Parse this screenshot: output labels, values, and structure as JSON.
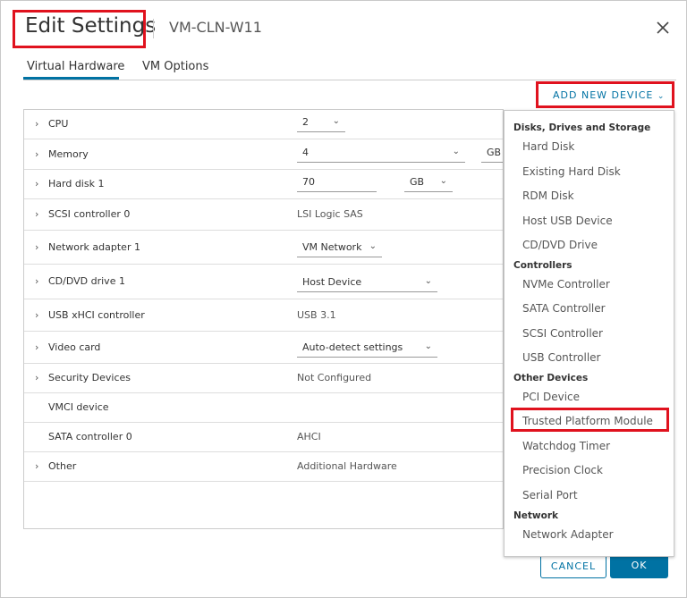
{
  "header": {
    "title": "Edit Settings",
    "vm_name": "VM-CLN-W11"
  },
  "tabs": [
    {
      "label": "Virtual Hardware",
      "active": true
    },
    {
      "label": "VM Options",
      "active": false
    }
  ],
  "toolbar": {
    "add_device_label": "ADD NEW DEVICE"
  },
  "hardware": {
    "cpu": {
      "label": "CPU",
      "value": "2"
    },
    "memory": {
      "label": "Memory",
      "value": "4",
      "unit": "GB"
    },
    "hard_disk": {
      "label": "Hard disk 1",
      "value": "70",
      "unit": "GB"
    },
    "scsi": {
      "label": "SCSI controller 0",
      "value": "LSI Logic SAS"
    },
    "network": {
      "label": "Network adapter 1",
      "value": "VM Network"
    },
    "cdrom": {
      "label": "CD/DVD drive 1",
      "value": "Host Device"
    },
    "usb": {
      "label": "USB xHCI controller",
      "value": "USB 3.1"
    },
    "video": {
      "label": "Video card",
      "value": "Auto-detect settings"
    },
    "security": {
      "label": "Security Devices",
      "value": "Not Configured"
    },
    "vmci": {
      "label": "VMCI device"
    },
    "sata": {
      "label": "SATA controller 0",
      "value": "AHCI"
    },
    "other": {
      "label": "Other",
      "value": "Additional Hardware"
    }
  },
  "menu": {
    "storage_header": "Disks, Drives and Storage",
    "storage": [
      "Hard Disk",
      "Existing Hard Disk",
      "RDM Disk",
      "Host USB Device",
      "CD/DVD Drive"
    ],
    "controllers_header": "Controllers",
    "controllers": [
      "NVMe Controller",
      "SATA Controller",
      "SCSI Controller",
      "USB Controller"
    ],
    "other_header": "Other Devices",
    "other": [
      "PCI Device",
      "Trusted Platform Module",
      "Watchdog Timer",
      "Precision Clock",
      "Serial Port"
    ],
    "network_header": "Network",
    "network": [
      "Network Adapter"
    ]
  },
  "footer": {
    "cancel_label": "CANCEL",
    "ok_label": "OK"
  },
  "colors": {
    "accent": "#0072a3",
    "highlight": "#e0121e"
  }
}
